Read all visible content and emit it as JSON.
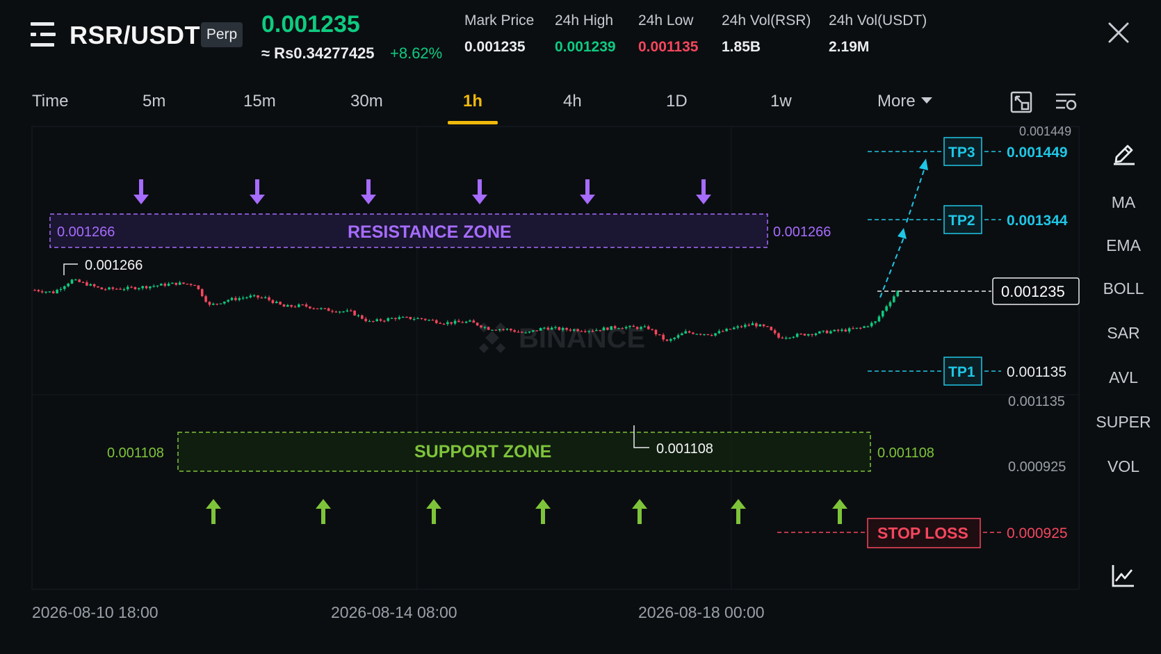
{
  "header": {
    "pair": "RSR/USDT",
    "contract": "Perp",
    "last_price": "0.001235",
    "inr_value": "≈ Rs0.34277425",
    "change": "+8.62%",
    "stats": [
      {
        "label": "Mark Price",
        "value": "0.001235",
        "color": "#eaecef"
      },
      {
        "label": "24h High",
        "value": "0.001239",
        "color": "#0ecb81"
      },
      {
        "label": "24h Low",
        "value": "0.001135",
        "color": "#f6465d"
      },
      {
        "label": "24h Vol(RSR)",
        "value": "1.85B",
        "color": "#eaecef"
      },
      {
        "label": "24h Vol(USDT)",
        "value": "2.19M",
        "color": "#eaecef"
      }
    ]
  },
  "tabs": {
    "items": [
      "Time",
      "5m",
      "15m",
      "30m",
      "1h",
      "4h",
      "1D",
      "1w"
    ],
    "active": "1h",
    "more": "More"
  },
  "sidebar": {
    "items": [
      "MA",
      "EMA",
      "BOLL",
      "SAR",
      "AVL",
      "SUPER",
      "VOL"
    ]
  },
  "time_axis": [
    "2026-08-10 18:00",
    "2026-08-14 08:00",
    "2026-08-18 00:00"
  ],
  "colors": {
    "up": "#0ecb81",
    "down": "#f6465d",
    "resistance": "#a66cff",
    "support": "#7ec43a",
    "target": "#1fc7e6",
    "stop": "#f6465d",
    "accent": "#f0b90b"
  },
  "chart_data": {
    "type": "candlestick",
    "watermark": "BINANCE",
    "y_axis_ticks": [
      "0.001449",
      "0.001135",
      "0.000925"
    ],
    "current_price": "0.001235",
    "resistance_zone": {
      "label": "RESISTANCE ZONE",
      "price": "0.001266"
    },
    "support_zone": {
      "label": "SUPPORT ZONE",
      "price": "0.001108"
    },
    "peak_label": "0.001266",
    "low_label": "0.001108",
    "targets": [
      {
        "label": "TP3",
        "price": "0.001449"
      },
      {
        "label": "TP2",
        "price": "0.001344"
      },
      {
        "label": "TP1",
        "price": "0.001135"
      }
    ],
    "stop_loss": {
      "label": "STOP LOSS",
      "price": "0.000925"
    },
    "price_path": [
      [
        0,
        0.001238
      ],
      [
        5,
        0.001232
      ],
      [
        10,
        0.001262
      ],
      [
        14,
        0.001252
      ],
      [
        18,
        0.00124
      ],
      [
        25,
        0.001242
      ],
      [
        32,
        0.001248
      ],
      [
        38,
        0.001254
      ],
      [
        43,
        0.001252
      ],
      [
        47,
        0.0012
      ],
      [
        52,
        0.001214
      ],
      [
        58,
        0.001222
      ],
      [
        62,
        0.001218
      ],
      [
        67,
        0.001197
      ],
      [
        72,
        0.0012
      ],
      [
        78,
        0.00119
      ],
      [
        85,
        0.001184
      ],
      [
        90,
        0.00116
      ],
      [
        97,
        0.00117
      ],
      [
        104,
        0.001168
      ],
      [
        110,
        0.001158
      ],
      [
        117,
        0.00116
      ],
      [
        122,
        0.001144
      ],
      [
        127,
        0.001142
      ],
      [
        132,
        0.001132
      ],
      [
        137,
        0.001146
      ],
      [
        142,
        0.001142
      ],
      [
        150,
        0.00114
      ],
      [
        157,
        0.001148
      ],
      [
        165,
        0.001145
      ],
      [
        170,
        0.001112
      ],
      [
        175,
        0.001135
      ],
      [
        182,
        0.00113
      ],
      [
        188,
        0.001145
      ],
      [
        193,
        0.001155
      ],
      [
        197,
        0.001145
      ],
      [
        200,
        0.001122
      ],
      [
        205,
        0.001128
      ],
      [
        212,
        0.001135
      ],
      [
        218,
        0.00114
      ],
      [
        222,
        0.001145
      ],
      [
        226,
        0.00116
      ],
      [
        229,
        0.0012
      ],
      [
        232,
        0.001235
      ]
    ]
  }
}
